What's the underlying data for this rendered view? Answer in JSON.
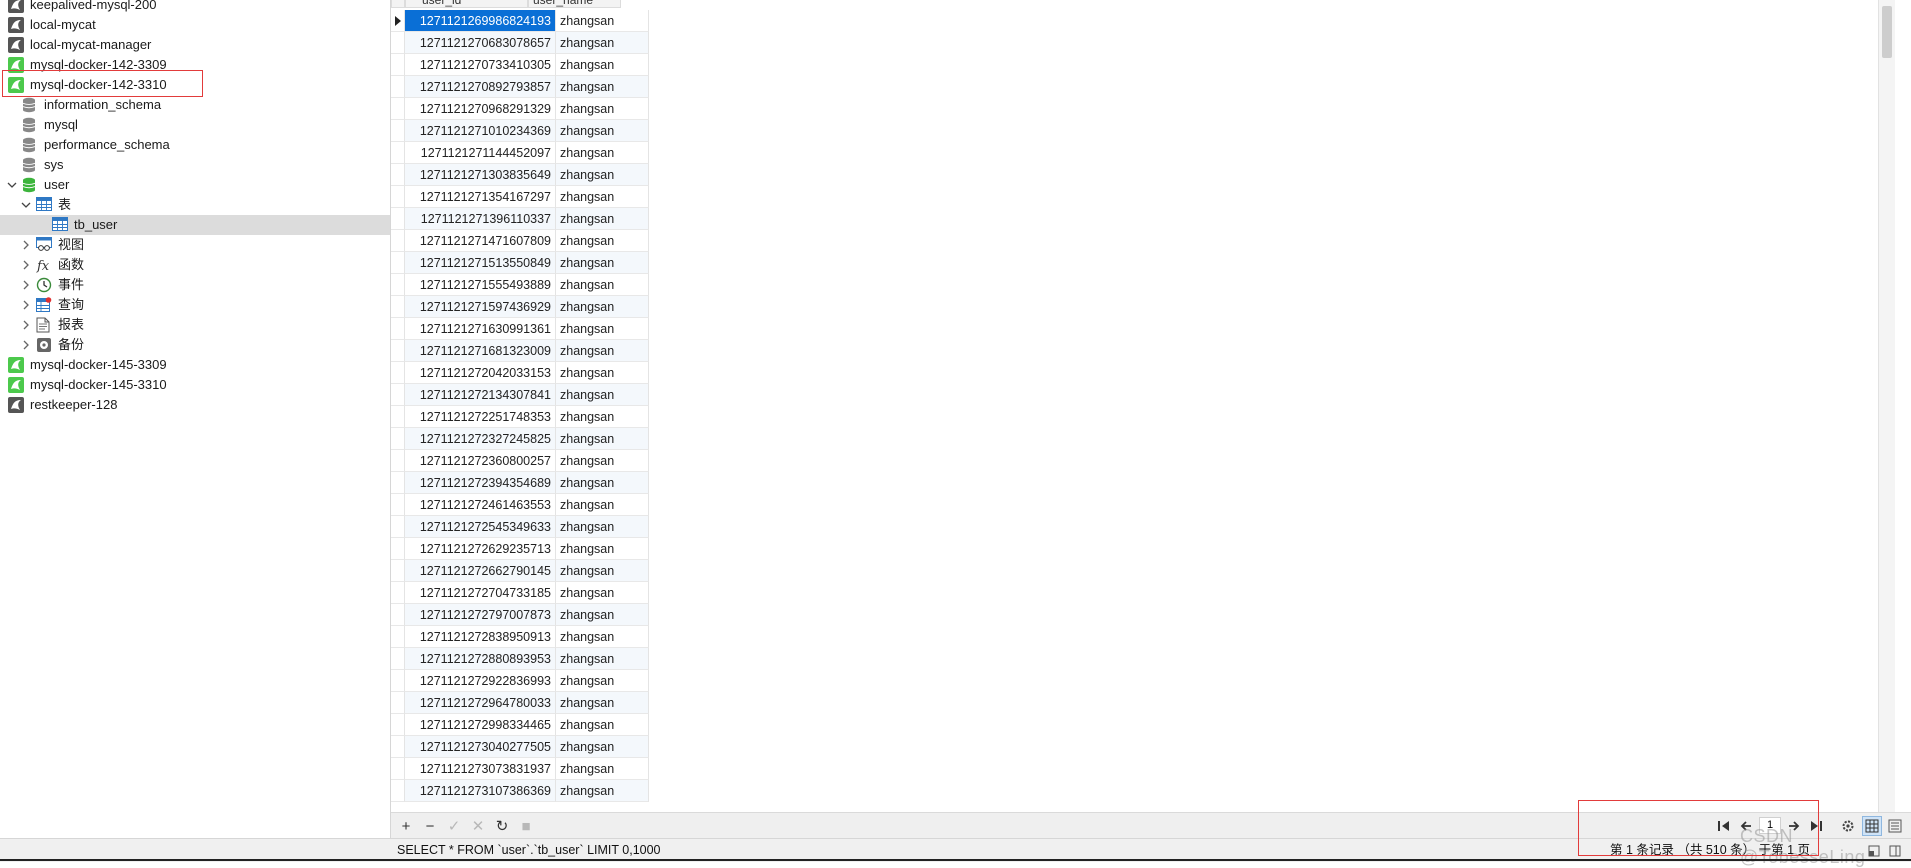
{
  "tree": {
    "connections_top": [
      {
        "label": "keepalived-mysql-200",
        "icon": "connection-icon-off"
      },
      {
        "label": "local-mycat",
        "icon": "connection-icon-off"
      },
      {
        "label": "local-mycat-manager",
        "icon": "connection-icon-off"
      },
      {
        "label": "mysql-docker-142-3309",
        "icon": "connection-icon-on"
      },
      {
        "label": "mysql-docker-142-3310",
        "icon": "connection-icon-on"
      }
    ],
    "databases": [
      {
        "label": "information_schema"
      },
      {
        "label": "mysql"
      },
      {
        "label": "performance_schema"
      },
      {
        "label": "sys"
      },
      {
        "label": "user"
      }
    ],
    "user_children": {
      "tables_label": "表",
      "table_item": "tb_user",
      "folders": [
        "视图",
        "函数",
        "事件",
        "查询",
        "报表",
        "备份"
      ]
    },
    "connections_bottom": [
      {
        "label": "mysql-docker-145-3309",
        "icon": "connection-icon-on"
      },
      {
        "label": "mysql-docker-145-3310",
        "icon": "connection-icon-on"
      },
      {
        "label": "restkeeper-128",
        "icon": "connection-icon-off"
      }
    ],
    "colors": {
      "active_connection": "#4cc94c",
      "inactive_connection": "#555555",
      "database": "#888888",
      "open_database": "#3cb43c"
    }
  },
  "grid": {
    "columns": [
      "user_id",
      "user_name"
    ],
    "rows": [
      [
        "1271121269986824193",
        "zhangsan"
      ],
      [
        "1271121270683078657",
        "zhangsan"
      ],
      [
        "1271121270733410305",
        "zhangsan"
      ],
      [
        "1271121270892793857",
        "zhangsan"
      ],
      [
        "1271121270968291329",
        "zhangsan"
      ],
      [
        "1271121271010234369",
        "zhangsan"
      ],
      [
        "1271121271144452097",
        "zhangsan"
      ],
      [
        "1271121271303835649",
        "zhangsan"
      ],
      [
        "1271121271354167297",
        "zhangsan"
      ],
      [
        "1271121271396110337",
        "zhangsan"
      ],
      [
        "1271121271471607809",
        "zhangsan"
      ],
      [
        "1271121271513550849",
        "zhangsan"
      ],
      [
        "1271121271555493889",
        "zhangsan"
      ],
      [
        "1271121271597436929",
        "zhangsan"
      ],
      [
        "1271121271630991361",
        "zhangsan"
      ],
      [
        "1271121271681323009",
        "zhangsan"
      ],
      [
        "1271121272042033153",
        "zhangsan"
      ],
      [
        "1271121272134307841",
        "zhangsan"
      ],
      [
        "1271121272251748353",
        "zhangsan"
      ],
      [
        "1271121272327245825",
        "zhangsan"
      ],
      [
        "1271121272360800257",
        "zhangsan"
      ],
      [
        "1271121272394354689",
        "zhangsan"
      ],
      [
        "1271121272461463553",
        "zhangsan"
      ],
      [
        "1271121272545349633",
        "zhangsan"
      ],
      [
        "1271121272629235713",
        "zhangsan"
      ],
      [
        "1271121272662790145",
        "zhangsan"
      ],
      [
        "1271121272704733185",
        "zhangsan"
      ],
      [
        "1271121272797007873",
        "zhangsan"
      ],
      [
        "1271121272838950913",
        "zhangsan"
      ],
      [
        "1271121272880893953",
        "zhangsan"
      ],
      [
        "1271121272922836993",
        "zhangsan"
      ],
      [
        "1271121272964780033",
        "zhangsan"
      ],
      [
        "1271121272998334465",
        "zhangsan"
      ],
      [
        "1271121273040277505",
        "zhangsan"
      ],
      [
        "1271121273073831937",
        "zhangsan"
      ],
      [
        "1271121273107386369",
        "zhangsan"
      ]
    ],
    "selection_color": "#0a6fd6"
  },
  "toolbar": {
    "buttons": [
      {
        "name": "add-record-button",
        "glyph": "+",
        "enabled": true
      },
      {
        "name": "delete-record-button",
        "glyph": "−",
        "enabled": true
      },
      {
        "name": "apply-changes-button",
        "glyph": "✓",
        "enabled": false
      },
      {
        "name": "discard-changes-button",
        "glyph": "✕",
        "enabled": false
      },
      {
        "name": "refresh-button",
        "glyph": "↻",
        "enabled": true
      },
      {
        "name": "stop-button",
        "glyph": "■",
        "enabled": false
      }
    ],
    "page_value": "1"
  },
  "status": {
    "sql": "SELECT * FROM `user`.`tb_user` LIMIT 0,1000",
    "records": "第 1 条记录 （共 510 条） 于第 1 页"
  },
  "watermark": "CSDN @TobesseLing",
  "annotation_color": "#e23b3b"
}
